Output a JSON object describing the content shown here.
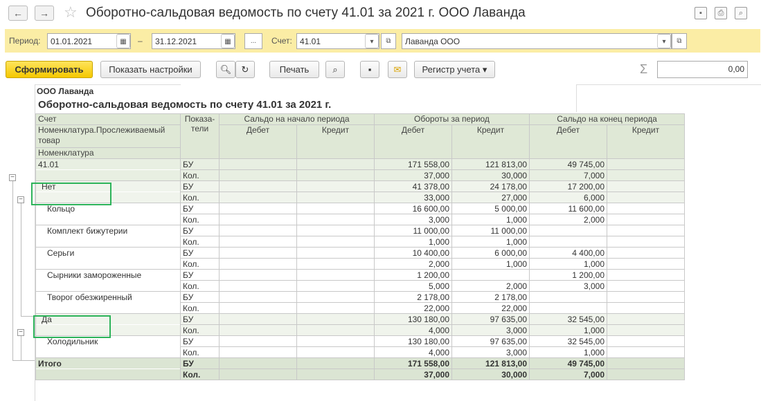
{
  "window": {
    "title": "Оборотно-сальдовая ведомость по счету 41.01 за 2021 г. ООО Лаванда",
    "back_icon": "←",
    "forward_icon": "→",
    "favorite_icon": "☆"
  },
  "params": {
    "period_label": "Период:",
    "date_from": "01.01.2021",
    "dash": "–",
    "date_to": "31.12.2021",
    "more_label": "...",
    "account_label": "Счет:",
    "account": "41.01",
    "organization": "Лаванда ООО"
  },
  "toolbar": {
    "generate": "Сформировать",
    "settings": "Показать настройки",
    "print": "Печать",
    "register": "Регистр учета",
    "sigma": "Σ",
    "sum_value": "0,00"
  },
  "report": {
    "org": "ООО Лаванда",
    "title": "Оборотно-сальдовая ведомость по счету 41.01 за 2021 г.",
    "headers": {
      "account": "Счет",
      "nomen_trace": "Номенклатура.Прослеживаемый товар",
      "nomen": "Номенклатура",
      "indicators": "Показа-тели",
      "opening": "Сальдо на начало периода",
      "turnover": "Обороты за период",
      "closing": "Сальдо на конец периода",
      "debit": "Дебет",
      "credit": "Кредит"
    },
    "rows": [
      {
        "name": "41.01",
        "level": "g0",
        "bu": [
          "",
          "",
          "171 558,00",
          "121 813,00",
          "49 745,00",
          ""
        ],
        "kol": [
          "",
          "",
          "37,000",
          "30,000",
          "7,000",
          ""
        ]
      },
      {
        "name": "Нет",
        "level": "g1",
        "bu": [
          "",
          "",
          "41 378,00",
          "24 178,00",
          "17 200,00",
          ""
        ],
        "kol": [
          "",
          "",
          "33,000",
          "27,000",
          "6,000",
          ""
        ]
      },
      {
        "name": "Кольцо",
        "level": "item",
        "bu": [
          "",
          "",
          "16 600,00",
          "5 000,00",
          "11 600,00",
          ""
        ],
        "kol": [
          "",
          "",
          "3,000",
          "1,000",
          "2,000",
          ""
        ]
      },
      {
        "name": "Комплект бижутерии",
        "level": "item",
        "bu": [
          "",
          "",
          "11 000,00",
          "11 000,00",
          "",
          ""
        ],
        "kol": [
          "",
          "",
          "1,000",
          "1,000",
          "",
          ""
        ]
      },
      {
        "name": "Серьги",
        "level": "item",
        "bu": [
          "",
          "",
          "10 400,00",
          "6 000,00",
          "4 400,00",
          ""
        ],
        "kol": [
          "",
          "",
          "2,000",
          "1,000",
          "1,000",
          ""
        ]
      },
      {
        "name": "Сырники замороженные",
        "level": "item",
        "bu": [
          "",
          "",
          "1 200,00",
          "",
          "1 200,00",
          ""
        ],
        "kol": [
          "",
          "",
          "5,000",
          "2,000",
          "3,000",
          ""
        ]
      },
      {
        "name": "Творог обезжиренный",
        "level": "item",
        "bu": [
          "",
          "",
          "2 178,00",
          "2 178,00",
          "",
          ""
        ],
        "kol": [
          "",
          "",
          "22,000",
          "22,000",
          "",
          ""
        ]
      },
      {
        "name": "Да",
        "level": "g1",
        "bu": [
          "",
          "",
          "130 180,00",
          "97 635,00",
          "32 545,00",
          ""
        ],
        "kol": [
          "",
          "",
          "4,000",
          "3,000",
          "1,000",
          ""
        ]
      },
      {
        "name": "Холодильник",
        "level": "item",
        "bu": [
          "",
          "",
          "130 180,00",
          "97 635,00",
          "32 545,00",
          ""
        ],
        "kol": [
          "",
          "",
          "4,000",
          "3,000",
          "1,000",
          ""
        ]
      }
    ],
    "total": {
      "name": "Итого",
      "bu": [
        "",
        "",
        "171 558,00",
        "121 813,00",
        "49 745,00",
        ""
      ],
      "kol": [
        "",
        "",
        "37,000",
        "30,000",
        "7,000",
        ""
      ]
    },
    "bu_label": "БУ",
    "kol_label": "Кол."
  }
}
